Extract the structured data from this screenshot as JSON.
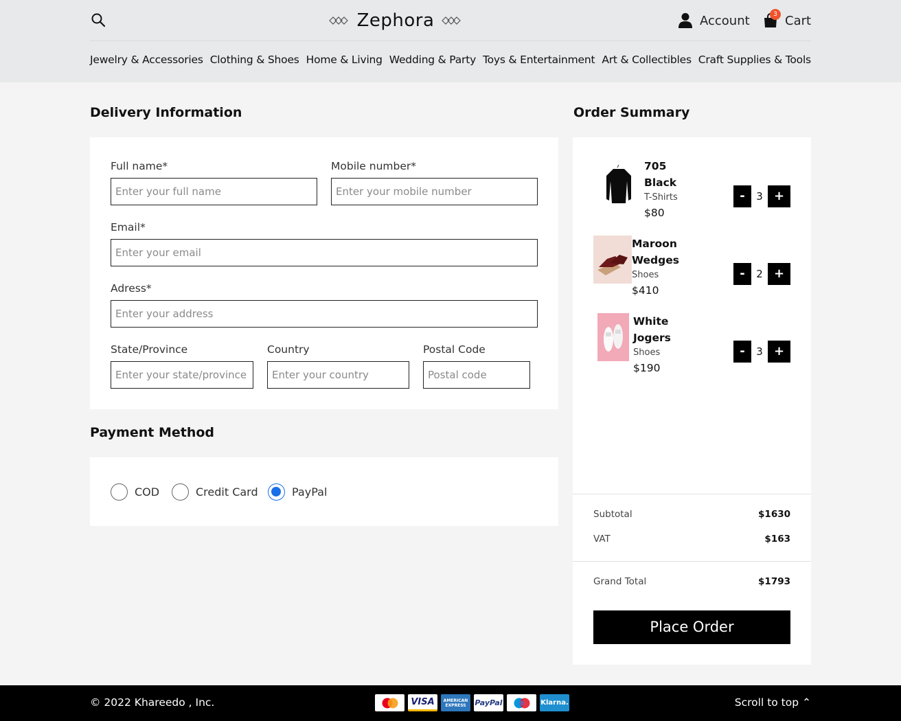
{
  "brand": {
    "name": "Zephora"
  },
  "header": {
    "account_label": "Account",
    "cart_label": "Cart",
    "cart_count": "3",
    "icons": [
      "search-icon",
      "user-icon",
      "shopping-bag-icon"
    ]
  },
  "nav": {
    "items": [
      "Jewelry & Accessories",
      "Clothing & Shoes",
      "Home & Living",
      "Wedding & Party",
      "Toys & Entertainment",
      "Art & Collectibles",
      "Craft Supplies & Tools"
    ]
  },
  "delivery": {
    "title": "Delivery Information",
    "full_name": {
      "label": "Full name*",
      "placeholder": "Enter your full name"
    },
    "mobile": {
      "label": "Mobile number*",
      "placeholder": "Enter your mobile number"
    },
    "email": {
      "label": "Email*",
      "placeholder": "Enter your email"
    },
    "address": {
      "label": "Adress*",
      "placeholder": "Enter your address"
    },
    "state": {
      "label": "State/Province",
      "placeholder": "Enter your state/province"
    },
    "country": {
      "label": "Country",
      "placeholder": "Enter your country"
    },
    "postal": {
      "label": "Postal Code",
      "placeholder": "Postal code"
    }
  },
  "payment": {
    "title": "Payment Method",
    "options": [
      "COD",
      "Credit Card",
      "PayPal"
    ],
    "selected": "PayPal"
  },
  "summary": {
    "title": "Order Summary",
    "items": [
      {
        "name_line1": "705",
        "name_line2": "Black",
        "category": "T-Shirts",
        "price": "$80",
        "qty": "3"
      },
      {
        "name_line1": "Maroon",
        "name_line2": "Wedges",
        "category": "Shoes",
        "price": "$410",
        "qty": "2"
      },
      {
        "name_line1": "White",
        "name_line2": "Jogers",
        "category": "Shoes",
        "price": "$190",
        "qty": "3"
      }
    ],
    "minus_label": "-",
    "plus_label": "+",
    "subtotal_label": "Subtotal",
    "subtotal_value": "$1630",
    "vat_label": "VAT",
    "vat_value": "$163",
    "grand_total_label": "Grand Total",
    "grand_total_value": "$1793",
    "place_order_label": "Place Order"
  },
  "footer": {
    "copyright": "© 2022 Khareedo , Inc.",
    "scroll_top": "Scroll to top ⌃",
    "payment_icons": [
      {
        "name": "mastercard-icon",
        "text": ""
      },
      {
        "name": "visa-icon",
        "text": "VISA"
      },
      {
        "name": "amex-icon",
        "text": "AMERICAN EXPRESS"
      },
      {
        "name": "paypal-icon",
        "text": "PayPal"
      },
      {
        "name": "maestro-icon",
        "text": ""
      },
      {
        "name": "klarna-icon",
        "text": "Klarna."
      }
    ]
  },
  "colors": {
    "header_bg": "#e8e9ea",
    "page_bg": "#f3f4f3",
    "accent": "#1a6fe8",
    "badge": "#f0542d",
    "button": "#000000"
  }
}
